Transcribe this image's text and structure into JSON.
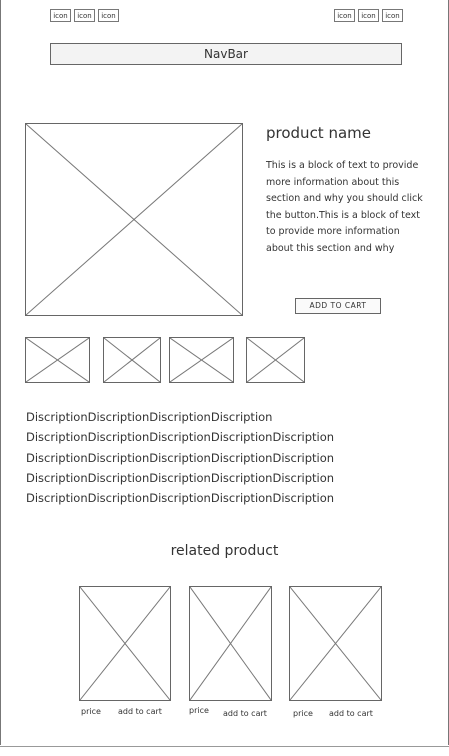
{
  "header": {
    "left_icons": [
      "icon",
      "icon",
      "icon"
    ],
    "right_icons": [
      "icon",
      "icon",
      "icon"
    ]
  },
  "navbar": {
    "label": "NavBar"
  },
  "product": {
    "name": "product name",
    "description": "This is a block of text to provide more information about this section and why you should click the button.This is a block of text to provide more information about this section and why",
    "add_to_cart_label": "ADD TO CART"
  },
  "description_lines": [
    "DiscriptionDiscriptionDiscriptionDiscription",
    "DiscriptionDiscriptionDiscriptionDiscriptionDiscription",
    "DiscriptionDiscriptionDiscriptionDiscriptionDiscription",
    "DiscriptionDiscriptionDiscriptionDiscriptionDiscription",
    "DiscriptionDiscriptionDiscriptionDiscriptionDiscription"
  ],
  "related": {
    "title": "related product",
    "items": [
      {
        "price_label": "price",
        "cart_label": "add to cart"
      },
      {
        "price_label": "price",
        "cart_label": "add to cart"
      },
      {
        "price_label": "price",
        "cart_label": "add to cart"
      }
    ]
  }
}
